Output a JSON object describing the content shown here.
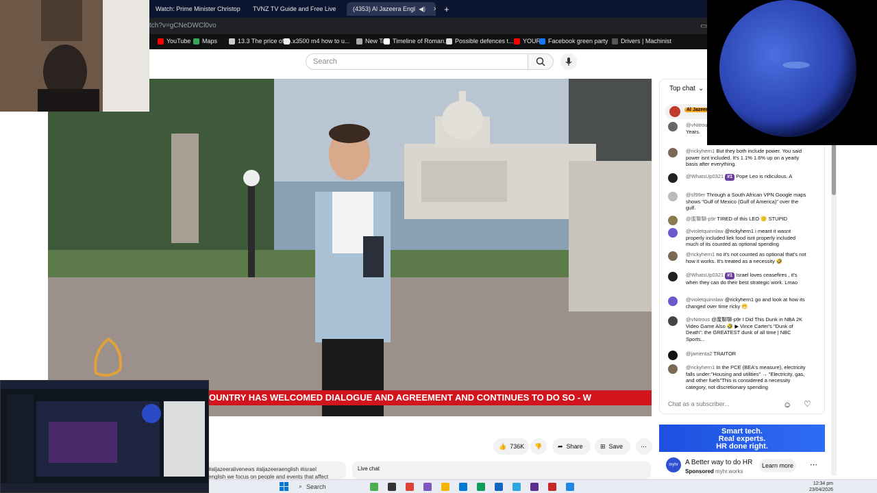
{
  "browser": {
    "tabs": [
      {
        "label": "Watch: Prime Minister Christop",
        "icon_color": "#e53935"
      },
      {
        "label": "TVNZ TV Guide and Free Live",
        "icon_color": "#1e88e5"
      },
      {
        "label": "(4353) Al Jazeera Engl",
        "icon_color": "#ff0000"
      }
    ],
    "new_tab_label": "+",
    "url": "tch?v=gCNeDWCl0vo",
    "bookmarks": [
      {
        "label": "YouTube",
        "color": "#ff0000"
      },
      {
        "label": "Maps",
        "color": "#34a853"
      },
      {
        "label": "13.3 The price of to...",
        "color": "#cccccc"
      },
      {
        "label": "x3500 m4 how to u...",
        "color": "#eeeeee"
      },
      {
        "label": "New Tab",
        "color": "#aaaaaa"
      },
      {
        "label": "Timeline of Roman...",
        "color": "#ffffff"
      },
      {
        "label": "Possible defences t...",
        "color": "#dddddd"
      },
      {
        "label": "YOUR",
        "color": "#ff0000"
      },
      {
        "label": "Facebook green party",
        "color": "#1877f2"
      },
      {
        "label": "Drivers | Machinist",
        "color": "#555555"
      }
    ]
  },
  "youtube": {
    "search_placeholder": "Search",
    "ticker_text": "OUNTRY HAS WELCOMED DIALOGUE AND AGREEMENT AND CONTINUES TO DO SO  -  W",
    "actions": {
      "likes": "736K",
      "share": "Share",
      "save": "Save"
    },
    "description_tags": "#aljazeeralivenews #aljazeeraenglish #israel",
    "description_line2": "english   we focus on people and events that affect",
    "live_chat_label": "Live chat"
  },
  "chat": {
    "header": "Top chat",
    "pinned_label": "Al Jazeer",
    "messages": [
      {
        "author": "@vNitrou",
        "text": "The MOS",
        "text2": "Years.",
        "avatar": "#666666"
      },
      {
        "author": "@rickyhern1",
        "text": "But they both include power. You said power isnt included. It's 1.1% 1.6% up on a yearly basis after everything.",
        "avatar": "#7a6a55"
      },
      {
        "author": "@WhatsUp0321",
        "badge": "#1",
        "text": "Pope Leo is ridiculous. A",
        "avatar": "#222222"
      },
      {
        "author": "@sf99er",
        "text": "Through a South African VPN Google maps shows \"Gulf of Mexico (Gulf of America)\" over the gulf.",
        "avatar": "#bbbbbb"
      },
      {
        "author": "@废聊聊-p9r",
        "text": "TIRED of this LEO 🙂 STUPID",
        "avatar": "#8a7a50"
      },
      {
        "author": "@violetquinnlaw",
        "text": "@rickyhern1 i meant it wasnt properly included liek food isnt properly included much of its counted as optional spending",
        "avatar": "#6a5acd"
      },
      {
        "author": "@rickyhern1",
        "text": "no it's not counted as optional that's not how it works. It's treated as a necessity 🤣",
        "avatar": "#7a6a55"
      },
      {
        "author": "@WhatsUp0321",
        "badge": "#1",
        "text": "Israel loves ceasefires , it's when they can do their best strategic work. Lmao",
        "avatar": "#222222"
      },
      {
        "author": "@violetquinnlaw",
        "text": "@rickyhern1 go and look at how its changed over time ricky 😬",
        "avatar": "#6a5acd"
      },
      {
        "author": "@vNitrous",
        "text": "@废聊聊-p9r I Did This Dunk in NBA 2K Video Game Also 🤣 ▶ Vince Carter's \"Dunk of Death\": the GREATEST dunk of all time | NBC Sports...",
        "avatar": "#444444"
      },
      {
        "author": "@jamenta2",
        "text": "TRAITOR",
        "avatar": "#111111"
      },
      {
        "author": "@rickyhern1",
        "text": "In the PCE (BEA's measure), electricity falls under:\"Housing and utilities\" → \"Electricity, gas, and other fuels\"This is considered a necessity category, not discretionary spending",
        "avatar": "#7a6a55"
      }
    ],
    "input_placeholder": "Chat as a subscriber..."
  },
  "ad": {
    "banner_line1": "Smart tech.",
    "banner_line2": "Real experts.",
    "banner_line3": "HR done right.",
    "title": "A Better way to do HR",
    "sponsored": "Sponsored",
    "domain": "myhr.works",
    "button": "Learn more",
    "logo_text": "myhr"
  },
  "taskbar": {
    "search_label": "Search",
    "time": "12:34 pm",
    "date": "23/04/2026"
  }
}
